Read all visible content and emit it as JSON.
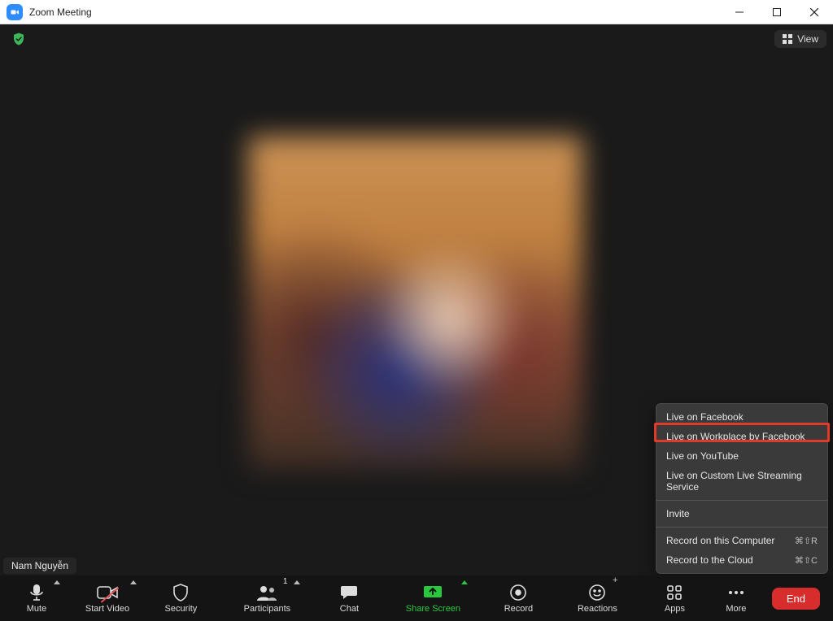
{
  "window": {
    "title": "Zoom Meeting"
  },
  "top": {
    "view_label": "View"
  },
  "participant_name": "Nam Nguyễn",
  "toolbar": {
    "mute": "Mute",
    "start_video": "Start Video",
    "security": "Security",
    "participants": "Participants",
    "participants_count": "1",
    "chat": "Chat",
    "share_screen": "Share Screen",
    "record": "Record",
    "reactions": "Reactions",
    "apps": "Apps",
    "more": "More",
    "end": "End"
  },
  "more_menu": {
    "items": [
      "Live on Facebook",
      "Live on Workplace by Facebook",
      "Live on YouTube",
      "Live on Custom Live Streaming Service"
    ],
    "invite": "Invite",
    "record_local": "Record on this Computer",
    "record_local_shortcut": "⌘⇧R",
    "record_cloud": "Record to the Cloud",
    "record_cloud_shortcut": "⌘⇧C"
  }
}
